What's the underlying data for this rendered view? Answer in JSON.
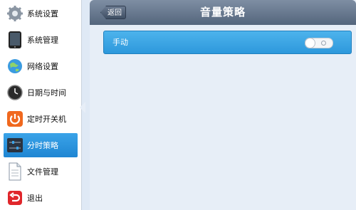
{
  "sidebar": {
    "items": [
      {
        "label": "系统设置",
        "icon": "gear-icon"
      },
      {
        "label": "系统管理",
        "icon": "tablet-icon"
      },
      {
        "label": "网络设置",
        "icon": "globe-icon"
      },
      {
        "label": "日期与时间",
        "icon": "clock-icon"
      },
      {
        "label": "定时开关机",
        "icon": "power-icon"
      },
      {
        "label": "分时策略",
        "icon": "sliders-icon",
        "active": true
      },
      {
        "label": "文件管理",
        "icon": "document-icon"
      },
      {
        "label": "退出",
        "icon": "exit-icon"
      }
    ]
  },
  "header": {
    "back_label": "返回",
    "title": "音量策略"
  },
  "settings": {
    "manual_label": "手动",
    "manual_on": false
  },
  "colors": {
    "accent": "#2d98dc",
    "header": "#54657c"
  }
}
